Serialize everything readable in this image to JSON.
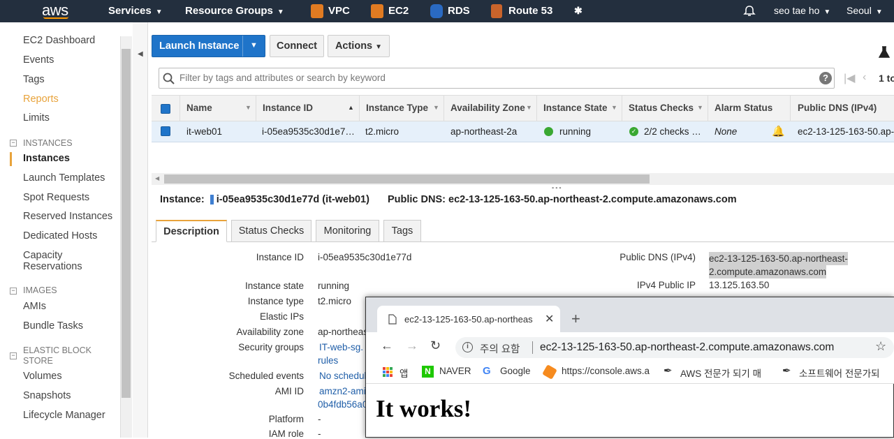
{
  "topbar": {
    "logo": "aws",
    "services": "Services",
    "resource_groups": "Resource Groups",
    "vpc": "VPC",
    "ec2": "EC2",
    "rds": "RDS",
    "route53": "Route 53",
    "user": "seo tae ho",
    "region": "Seoul",
    "colors": {
      "bar": "#232f3e",
      "vpc": "#e07b22",
      "ec2": "#e07b22",
      "rds": "#2a6ac2",
      "route53": "#c9642b"
    }
  },
  "sidebar": {
    "items_top": [
      "EC2 Dashboard",
      "Events",
      "Tags",
      "Reports",
      "Limits"
    ],
    "section_instances": "INSTANCES",
    "instances_items": [
      "Instances",
      "Launch Templates",
      "Spot Requests",
      "Reserved Instances",
      "Dedicated Hosts"
    ],
    "capacity_line1": "Capacity",
    "capacity_line2": "Reservations",
    "section_images": "IMAGES",
    "images_items": [
      "AMIs",
      "Bundle Tasks"
    ],
    "section_ebs_line1": "ELASTIC BLOCK",
    "section_ebs_line2": "STORE",
    "ebs_items": [
      "Volumes",
      "Snapshots",
      "Lifecycle Manager"
    ]
  },
  "toolbar": {
    "launch": "Launch Instance",
    "connect": "Connect",
    "actions": "Actions"
  },
  "search": {
    "placeholder": "Filter by tags and attributes or search by keyword",
    "pagination": "1 to"
  },
  "table": {
    "headers": [
      "Name",
      "Instance ID",
      "Instance Type",
      "Availability Zone",
      "Instance State",
      "Status Checks",
      "Alarm Status",
      "Public DNS (IPv4)"
    ],
    "row": {
      "name": "it-web01",
      "instance_id": "i-05ea9535c30d1e7…",
      "type": "t2.micro",
      "az": "ap-northeast-2a",
      "state": "running",
      "checks": "2/2 checks …",
      "alarm": "None",
      "dns": "ec2-13-125-163-50.ap-…"
    }
  },
  "detail": {
    "instance_label": "Instance:",
    "instance_value": "i-05ea9535c30d1e77d (it-web01)",
    "dns_label": "Public DNS:",
    "dns_value": "ec2-13-125-163-50.ap-northeast-2.compute.amazonaws.com",
    "tabs": [
      "Description",
      "Status Checks",
      "Monitoring",
      "Tags"
    ],
    "fields": {
      "instance_id_label": "Instance ID",
      "instance_id": "i-05ea9535c30d1e77d",
      "state_label": "Instance state",
      "state": "running",
      "type_label": "Instance type",
      "type": "t2.micro",
      "eip_label": "Elastic IPs",
      "az_label": "Availability zone",
      "az": "ap-northeas",
      "sg_label": "Security groups",
      "sg": "IT-web-sg.",
      "sg_rules": "rules",
      "sched_label": "Scheduled events",
      "sched": "No schedul",
      "ami_label": "AMI ID",
      "ami": "amzn2-ami",
      "ami2": "0b4fdb56a0",
      "platform_label": "Platform",
      "platform": "-",
      "iam_label": "IAM role",
      "iam": "-",
      "pubdns_label": "Public DNS (IPv4)",
      "pubdns1": "ec2-13-125-163-50.ap-northeast-",
      "pubdns2": "2.compute.amazonaws.com",
      "ip_label": "IPv4 Public IP",
      "ip": "13.125.163.50"
    }
  },
  "browser": {
    "tab_title": "ec2-13-125-163-50.ap-northeas",
    "security": "주의 요함",
    "url": "ec2-13-125-163-50.ap-northeast-2.compute.amazonaws.com",
    "bookmarks": [
      "앱",
      "NAVER",
      "Google",
      "https://console.aws.a",
      "AWS 전문가 되기 매",
      "소프트웨어 전문가되"
    ],
    "heading": "It works!"
  }
}
